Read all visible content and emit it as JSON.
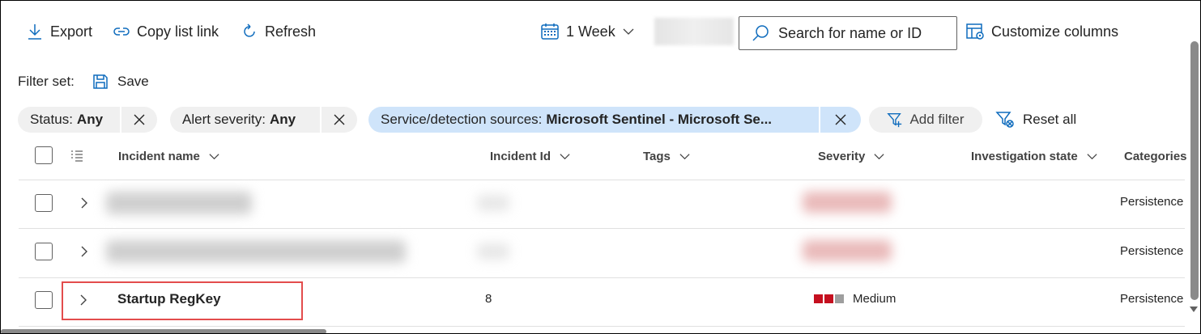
{
  "toolbar": {
    "export_label": "Export",
    "copy_link_label": "Copy list link",
    "refresh_label": "Refresh",
    "time_range": "1 Week",
    "search_placeholder": "Search for name or ID",
    "customize_label": "Customize columns"
  },
  "filter_set": {
    "label": "Filter set:",
    "save_label": "Save"
  },
  "filters": [
    {
      "key": "Status:",
      "value": "Any"
    },
    {
      "key": "Alert severity:",
      "value": "Any"
    },
    {
      "key": "Service/detection sources:",
      "value": "Microsoft Sentinel - Microsoft Se..."
    }
  ],
  "filter_actions": {
    "add_filter": "Add filter",
    "reset_all": "Reset all"
  },
  "columns": {
    "incident_name": "Incident name",
    "incident_id": "Incident Id",
    "tags": "Tags",
    "severity": "Severity",
    "investigation_state": "Investigation state",
    "categories": "Categories"
  },
  "rows": [
    {
      "name": "",
      "id": "",
      "severity": "",
      "category": "Persistence",
      "redacted": true
    },
    {
      "name": "",
      "id": "",
      "severity": "",
      "category": "Persistence",
      "redacted": true
    },
    {
      "name": "Startup RegKey",
      "id": "8",
      "severity": "Medium",
      "category": "Persistence",
      "redacted": false
    }
  ],
  "colors": {
    "accent": "#0f6cbd",
    "severity_medium": "#c50f1f",
    "highlight_box": "#e34c4c",
    "filter_pill_active": "#cfe4fa"
  }
}
